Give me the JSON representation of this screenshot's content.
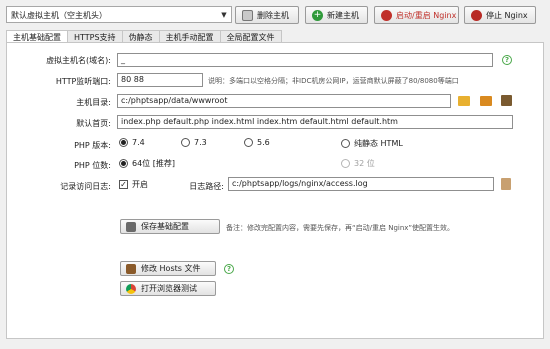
{
  "toolbar": {
    "host_select_value": "默认虚拟主机（空主机头）",
    "delete_host_label": "删除主机",
    "new_host_label": "新建主机",
    "restart_nginx_label": "启动/重启 Nginx",
    "stop_nginx_label": "停止 Nginx"
  },
  "tabs": [
    {
      "label": "主机基础配置"
    },
    {
      "label": "HTTPS支持"
    },
    {
      "label": "伪静态"
    },
    {
      "label": "主机手动配置"
    },
    {
      "label": "全局配置文件"
    }
  ],
  "form": {
    "hostname_label": "虚拟主机名(域名):",
    "hostname_value": "_",
    "port_label": "HTTP监听端口:",
    "port_value": "80 88",
    "port_note": "说明：多端口以空格分隔；非IDC机房公网IP，运营商默认屏蔽了80/8080等端口",
    "root_label": "主机目录:",
    "root_value": "c:/phptsapp/data/wwwroot",
    "index_label": "默认首页:",
    "index_value": "index.php default.php index.html index.htm default.html default.htm",
    "php_version_label": "PHP 版本:",
    "php_versions": [
      "7.4",
      "7.3",
      "5.6",
      "纯静态 HTML"
    ],
    "php_bits_label": "PHP 位数:",
    "php_bits": [
      "64位 [推荐]",
      "32 位"
    ],
    "log_label": "记录访问日志:",
    "log_enable_label": "开启",
    "log_path_label": "日志路径:",
    "log_path_value": "c:/phptsapp/logs/nginx/access.log",
    "check_mark": "✓"
  },
  "actions": {
    "save_label": "保存基础配置",
    "save_note": "备注：修改完配置内容，需要先保存，再“启动/重启 Nginx”使配置生效。",
    "hosts_label": "修改 Hosts 文件",
    "browser_label": "打开浏览器测试",
    "help_mark": "?"
  },
  "colors": {
    "help_green": "#4aa84a",
    "delete_red": "#d23a2a",
    "new_green": "#2f9a3a",
    "restart_red": "#c0302a",
    "stop_red": "#b82a25",
    "folder_yellow": "#e8b030"
  }
}
